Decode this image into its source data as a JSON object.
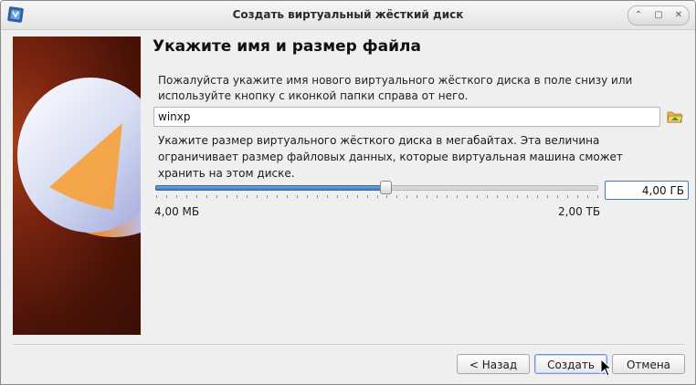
{
  "window": {
    "title": "Создать виртуальный жёсткий диск",
    "controls": [
      "restore-icon",
      "maximize-icon",
      "close-icon"
    ]
  },
  "page": {
    "heading": "Укажите имя и размер файла",
    "name_description": "Пожалуйста укажите имя нового виртуального жёсткого диска в поле снизу или используйте кнопку с иконкой папки справа от него.",
    "file_name": "winxp",
    "folder_button_icon": "folder-open-icon",
    "size_description": "Укажите размер виртуального жёсткого диска в мегабайтах. Эта величина ограничивает размер файловых данных, которые виртуальная машина сможет хранить на этом диске.",
    "size_value": "4,00 ГБ",
    "slider_min_label": "4,00 МБ",
    "slider_max_label": "2,00 ТБ",
    "slider_position_fraction": 0.52
  },
  "buttons": {
    "back": "< Назад",
    "create": "Создать",
    "cancel": "Отмена"
  },
  "colors": {
    "accent": "#3a7bc0",
    "side_image_bg": "#5a1a0a"
  }
}
